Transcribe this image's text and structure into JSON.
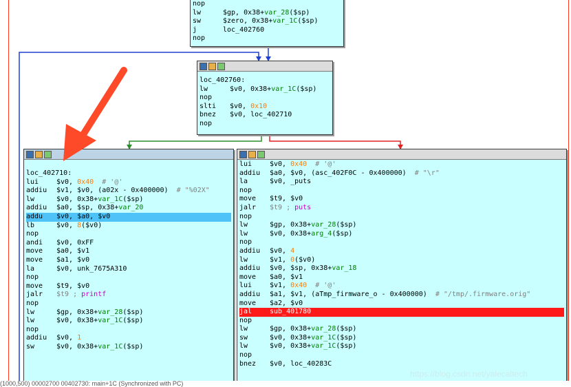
{
  "top_block": {
    "lines": [
      {
        "m": "nop",
        "o": []
      },
      {
        "m": "lw",
        "o": [
          {
            "t": "$gp, 0x38+"
          },
          {
            "t": "var_28",
            "c": "var"
          },
          {
            "t": "($sp)"
          }
        ]
      },
      {
        "m": "sw",
        "o": [
          {
            "t": "$zero, 0x38+"
          },
          {
            "t": "var_1C",
            "c": "var"
          },
          {
            "t": "($sp)"
          }
        ]
      },
      {
        "m": "j",
        "o": [
          {
            "t": "loc_402760"
          }
        ]
      },
      {
        "m": "nop",
        "o": []
      }
    ]
  },
  "mid_block": {
    "label": "loc_402760:",
    "lines": [
      {
        "m": "lw",
        "o": [
          {
            "t": "$v0, 0x38+"
          },
          {
            "t": "var_1C",
            "c": "var"
          },
          {
            "t": "($sp)"
          }
        ]
      },
      {
        "m": "nop",
        "o": []
      },
      {
        "m": "slti",
        "o": [
          {
            "t": "$v0, "
          },
          {
            "t": "0x10",
            "c": "num"
          }
        ]
      },
      {
        "m": "bnez",
        "o": [
          {
            "t": "$v0, loc_402710"
          }
        ]
      },
      {
        "m": "nop",
        "o": []
      }
    ]
  },
  "left_block": {
    "label": "loc_402710:",
    "lines": [
      {
        "m": "lui",
        "o": [
          {
            "t": "$v0, "
          },
          {
            "t": "0x40",
            "c": "num"
          },
          {
            "t": "  # '@'",
            "c": "cmt"
          }
        ]
      },
      {
        "m": "addiu",
        "o": [
          {
            "t": "$v1, $v0, (a02x - 0x400000)"
          },
          {
            "t": "  # \"%02X\"",
            "c": "cmt"
          }
        ]
      },
      {
        "m": "lw",
        "o": [
          {
            "t": "$v0, 0x38+"
          },
          {
            "t": "var_1C",
            "c": "var"
          },
          {
            "t": "($sp)"
          }
        ]
      },
      {
        "m": "addiu",
        "o": [
          {
            "t": "$a0, $sp, 0x38+"
          },
          {
            "t": "var_20",
            "c": "var"
          }
        ]
      },
      {
        "m": "addu",
        "o": [
          {
            "t": "$v0, $a0, $v0"
          }
        ],
        "hl": "blue"
      },
      {
        "m": "lb",
        "o": [
          {
            "t": "$v0, "
          },
          {
            "t": "8",
            "c": "num"
          },
          {
            "t": "($v0)"
          }
        ]
      },
      {
        "m": "nop",
        "o": []
      },
      {
        "m": "andi",
        "o": [
          {
            "t": "$v0, 0xFF"
          }
        ]
      },
      {
        "m": "move",
        "o": [
          {
            "t": "$a0, $v1"
          }
        ]
      },
      {
        "m": "move",
        "o": [
          {
            "t": "$a1, $v0"
          }
        ]
      },
      {
        "m": "la",
        "o": [
          {
            "t": "$v0, unk_7675A310"
          }
        ]
      },
      {
        "m": "nop",
        "o": []
      },
      {
        "m": "move",
        "o": [
          {
            "t": "$t9, $v0"
          }
        ]
      },
      {
        "m": "jalr",
        "o": [
          {
            "t": "$t9 ; ",
            "c": "cmt"
          },
          {
            "t": "printf",
            "c": "call"
          }
        ]
      },
      {
        "m": "nop",
        "o": []
      },
      {
        "m": "lw",
        "o": [
          {
            "t": "$gp, 0x38+"
          },
          {
            "t": "var_28",
            "c": "var"
          },
          {
            "t": "($sp)"
          }
        ]
      },
      {
        "m": "lw",
        "o": [
          {
            "t": "$v0, 0x38+"
          },
          {
            "t": "var_1C",
            "c": "var"
          },
          {
            "t": "($sp)"
          }
        ]
      },
      {
        "m": "nop",
        "o": []
      },
      {
        "m": "addiu",
        "o": [
          {
            "t": "$v0, "
          },
          {
            "t": "1",
            "c": "num"
          }
        ]
      },
      {
        "m": "sw",
        "o": [
          {
            "t": "$v0, 0x38+"
          },
          {
            "t": "var_1C",
            "c": "var"
          },
          {
            "t": "($sp)"
          }
        ]
      }
    ]
  },
  "right_block": {
    "lines": [
      {
        "m": "lui",
        "o": [
          {
            "t": "$v0, "
          },
          {
            "t": "0x40",
            "c": "num"
          },
          {
            "t": "  # '@'",
            "c": "cmt"
          }
        ]
      },
      {
        "m": "addiu",
        "o": [
          {
            "t": "$a0, $v0, (asc_402F0C - 0x400000)"
          },
          {
            "t": "  # \"\\r\"",
            "c": "cmt"
          }
        ]
      },
      {
        "m": "la",
        "o": [
          {
            "t": "$v0, _puts"
          }
        ]
      },
      {
        "m": "nop",
        "o": []
      },
      {
        "m": "move",
        "o": [
          {
            "t": "$t9, $v0"
          }
        ]
      },
      {
        "m": "jalr",
        "o": [
          {
            "t": "$t9 ; ",
            "c": "cmt"
          },
          {
            "t": "puts",
            "c": "call"
          }
        ]
      },
      {
        "m": "nop",
        "o": []
      },
      {
        "m": "lw",
        "o": [
          {
            "t": "$gp, 0x38+"
          },
          {
            "t": "var_28",
            "c": "var"
          },
          {
            "t": "($sp)"
          }
        ]
      },
      {
        "m": "lw",
        "o": [
          {
            "t": "$v0, 0x38+"
          },
          {
            "t": "arg_4",
            "c": "var"
          },
          {
            "t": "($sp)"
          }
        ]
      },
      {
        "m": "nop",
        "o": []
      },
      {
        "m": "addiu",
        "o": [
          {
            "t": "$v0, "
          },
          {
            "t": "4",
            "c": "num"
          }
        ]
      },
      {
        "m": "lw",
        "o": [
          {
            "t": "$v1, "
          },
          {
            "t": "0",
            "c": "num"
          },
          {
            "t": "($v0)"
          }
        ]
      },
      {
        "m": "addiu",
        "o": [
          {
            "t": "$v0, $sp, 0x38+"
          },
          {
            "t": "var_18",
            "c": "var"
          }
        ]
      },
      {
        "m": "move",
        "o": [
          {
            "t": "$a0, $v1"
          }
        ]
      },
      {
        "m": "lui",
        "o": [
          {
            "t": "$v1, "
          },
          {
            "t": "0x40",
            "c": "num"
          },
          {
            "t": "  # '@'",
            "c": "cmt"
          }
        ]
      },
      {
        "m": "addiu",
        "o": [
          {
            "t": "$a1, $v1, (aTmp_firmware_o - 0x400000)"
          },
          {
            "t": "  # \"/tmp/.firmware.orig\"",
            "c": "cmt"
          }
        ]
      },
      {
        "m": "move",
        "o": [
          {
            "t": "$a2, $v0"
          }
        ]
      },
      {
        "m": "jal",
        "o": [
          {
            "t": "sub_401780"
          }
        ],
        "hl": "red"
      },
      {
        "m": "nop",
        "o": []
      },
      {
        "m": "lw",
        "o": [
          {
            "t": "$gp, 0x38+"
          },
          {
            "t": "var_28",
            "c": "var"
          },
          {
            "t": "($sp)"
          }
        ]
      },
      {
        "m": "sw",
        "o": [
          {
            "t": "$v0, 0x38+"
          },
          {
            "t": "var_1C",
            "c": "var"
          },
          {
            "t": "($sp)"
          }
        ]
      },
      {
        "m": "lw",
        "o": [
          {
            "t": "$v0, 0x38+"
          },
          {
            "t": "var_1C",
            "c": "var"
          },
          {
            "t": "($sp)"
          }
        ]
      },
      {
        "m": "nop",
        "o": []
      },
      {
        "m": "bnez",
        "o": [
          {
            "t": "$v0, loc_40283C"
          }
        ]
      }
    ]
  },
  "watermark": "https://blog.csdn.net/yalecaltech",
  "statusbar": "(1000,500) 00002700 00402730: main+1C (Synchronized with PC)",
  "colors": {
    "node_bg": "#c9ffff",
    "numeric": "#ff7a00",
    "variable": "#008000",
    "comment": "#808080",
    "call": "#c000c0",
    "highlight_blue": "#4fc3f7",
    "highlight_red": "#ff1a1a",
    "edge_blue": "#1f3fd0",
    "edge_green": "#2a8f2a",
    "edge_red": "#e02020",
    "pointer_arrow": "#ff4a2a"
  }
}
